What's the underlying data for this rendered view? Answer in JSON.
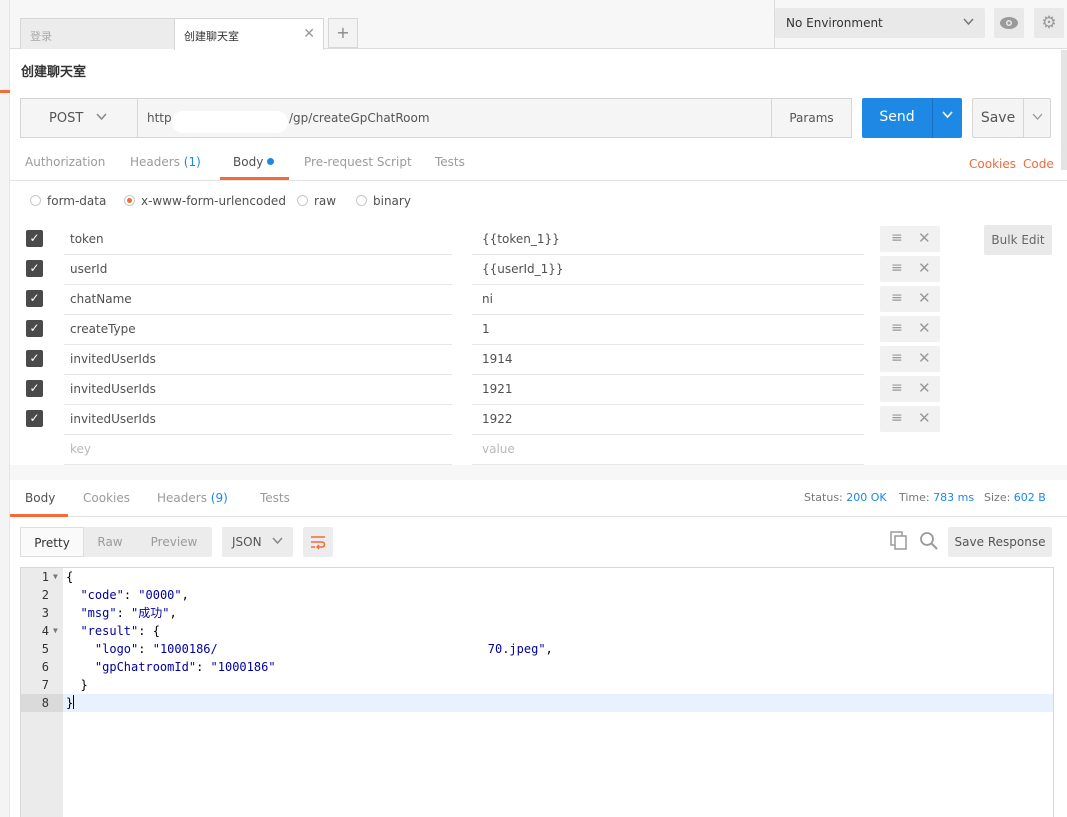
{
  "tabs": [
    {
      "label": "登录",
      "active": false
    },
    {
      "label": "创建聊天室",
      "active": true
    }
  ],
  "tab_close_glyph": "✕",
  "add_tab_glyph": "+",
  "environment": {
    "selected": "No Environment"
  },
  "icons": {
    "eye": "eye-icon",
    "settings": "gear-icon"
  },
  "request": {
    "title": "创建聊天室",
    "method": "POST",
    "url_prefix": "http",
    "url_path": "/gp/createGpChatRoom",
    "params_label": "Params",
    "send_label": "Send",
    "save_label": "Save"
  },
  "request_tabs": [
    {
      "label": "Authorization"
    },
    {
      "label": "Headers",
      "count": "(1)"
    },
    {
      "label": "Body",
      "active": true,
      "dot": true
    },
    {
      "label": "Pre-request Script"
    },
    {
      "label": "Tests"
    }
  ],
  "request_links": {
    "cookies": "Cookies",
    "code": "Code"
  },
  "body_modes": [
    {
      "label": "form-data",
      "checked": false
    },
    {
      "label": "x-www-form-urlencoded",
      "checked": true
    },
    {
      "label": "raw",
      "checked": false
    },
    {
      "label": "binary",
      "checked": false
    }
  ],
  "body_rows": [
    {
      "key": "token",
      "value": "{{token_1}}"
    },
    {
      "key": "userId",
      "value": "{{userId_1}}"
    },
    {
      "key": "chatName",
      "value": "ni"
    },
    {
      "key": "createType",
      "value": "1"
    },
    {
      "key": "invitedUserIds",
      "value": "1914"
    },
    {
      "key": "invitedUserIds",
      "value": "1921"
    },
    {
      "key": "invitedUserIds",
      "value": "1922"
    }
  ],
  "body_placeholders": {
    "key": "key",
    "value": "value"
  },
  "bulk_edit_label": "Bulk Edit",
  "response_tabs": [
    {
      "label": "Body",
      "active": true
    },
    {
      "label": "Cookies"
    },
    {
      "label": "Headers",
      "count": "(9)"
    },
    {
      "label": "Tests"
    }
  ],
  "response_status": {
    "status_label": "Status:",
    "status_value": "200 OK",
    "time_label": "Time:",
    "time_value": "783 ms",
    "size_label": "Size:",
    "size_value": "602 B"
  },
  "format_buttons": [
    {
      "label": "Pretty",
      "active": true
    },
    {
      "label": "Raw"
    },
    {
      "label": "Preview"
    }
  ],
  "format_select": "JSON",
  "save_response_label": "Save Response",
  "response_lines": [
    {
      "n": "1",
      "fold": true,
      "text": "{"
    },
    {
      "n": "2",
      "indent": "  ",
      "key": "\"code\"",
      "val": "\"0000\"",
      "trail": ","
    },
    {
      "n": "3",
      "indent": "  ",
      "key": "\"msg\"",
      "val": "\"成功\"",
      "trail": ","
    },
    {
      "n": "4",
      "fold": true,
      "indent": "  ",
      "key": "\"result\"",
      "open": " {"
    },
    {
      "n": "5",
      "indent": "    ",
      "key": "\"logo\"",
      "val_start": "\"1000186/",
      "val_end": "70.jpeg\"",
      "trail": ","
    },
    {
      "n": "6",
      "indent": "    ",
      "key": "\"gpChatroomId\"",
      "val": "\"1000186\""
    },
    {
      "n": "7",
      "text": "  }"
    },
    {
      "n": "8",
      "text": "}",
      "cursor": true
    }
  ]
}
